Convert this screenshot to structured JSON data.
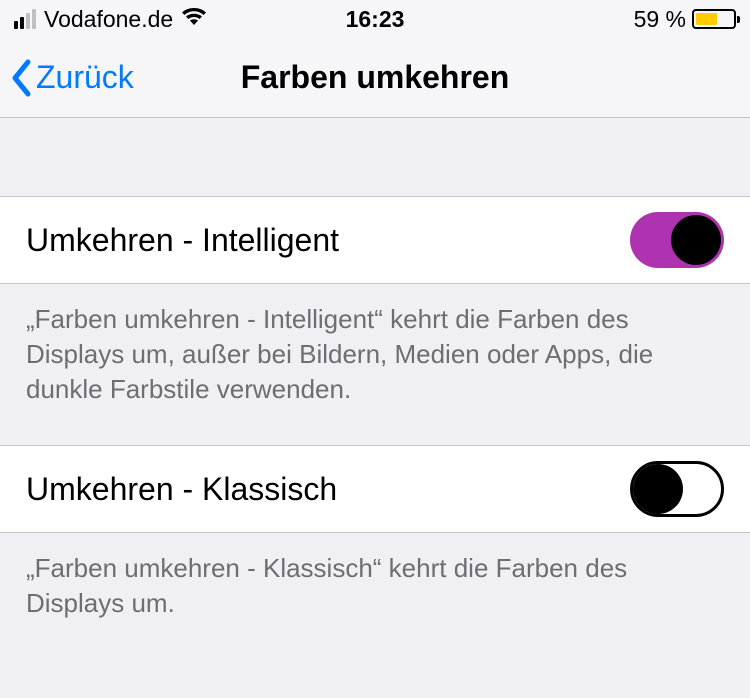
{
  "status": {
    "carrier": "Vodafone.de",
    "time": "16:23",
    "battery_pct": "59 %",
    "battery_level": 59
  },
  "nav": {
    "back_label": "Zurück",
    "title": "Farben umkehren"
  },
  "rows": {
    "smart": {
      "label": "Umkehren - Intelligent",
      "enabled": true,
      "footer": "„Farben umkehren - Intelligent“ kehrt die Farben des Displays um, außer bei Bildern, Medien oder Apps, die dunkle Farbstile verwenden."
    },
    "classic": {
      "label": "Umkehren - Klassisch",
      "enabled": false,
      "footer": "„Farben umkehren - Klassisch“ kehrt die Farben des Displays um."
    }
  },
  "colors": {
    "toggle_accent": "#af33b0",
    "battery_fill": "#ffcc00",
    "link_blue": "#007aff"
  }
}
